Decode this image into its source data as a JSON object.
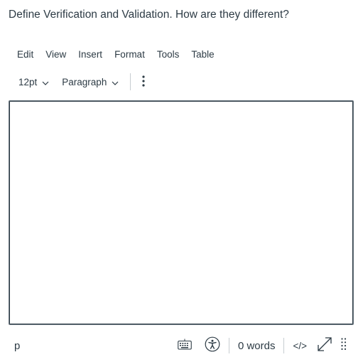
{
  "question": "Define Verification and Validation. How are they different?",
  "menubar": {
    "items": [
      "Edit",
      "View",
      "Insert",
      "Format",
      "Tools",
      "Table"
    ]
  },
  "toolbar": {
    "font_size": "12pt",
    "block_format": "Paragraph",
    "more_icon": "vertical-ellipsis-icon"
  },
  "editor": {
    "content": ""
  },
  "statusbar": {
    "path": "p",
    "word_count": "0 words",
    "html_toggle": "</>",
    "icons": [
      "keyboard-icon",
      "accessibility-icon",
      "fullscreen-icon",
      "resize-handle-icon"
    ]
  },
  "colors": {
    "text": "#2d3b45",
    "border": "#6b7780",
    "separator": "#c7cdd1"
  }
}
